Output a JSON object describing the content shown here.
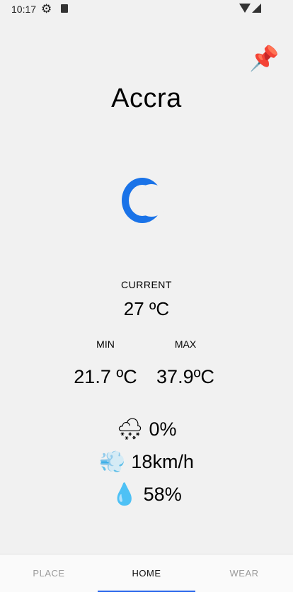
{
  "status_bar": {
    "time": "10:17",
    "icons": [
      "settings-gear-icon",
      "sd-card-icon",
      "wifi-icon",
      "signal-icon"
    ]
  },
  "pin": {
    "icon": "pushpin-icon",
    "glyph": "📌"
  },
  "city": "Accra",
  "condition_icon": "moon-icon",
  "current": {
    "label": "CURRENT",
    "value": "27 ºC"
  },
  "min": {
    "label": "MIN",
    "value": "21.7 ºC"
  },
  "max": {
    "label": "MAX",
    "value": "37.9ºC"
  },
  "stats": {
    "rain": {
      "icon": "rain-cloud-icon",
      "glyph": "🌨",
      "value": "0%"
    },
    "wind": {
      "icon": "wind-icon",
      "glyph": "💨",
      "value": "18km/h"
    },
    "humidity": {
      "icon": "droplet-icon",
      "glyph": "💧",
      "value": "58%"
    }
  },
  "nav": {
    "tabs": [
      {
        "label": "PLACE",
        "active": false
      },
      {
        "label": "HOME",
        "active": true
      },
      {
        "label": "WEAR",
        "active": false
      }
    ],
    "active_color": "#2563eb"
  },
  "colors": {
    "moon": "#1a73e8",
    "background": "#f1f1f1"
  }
}
